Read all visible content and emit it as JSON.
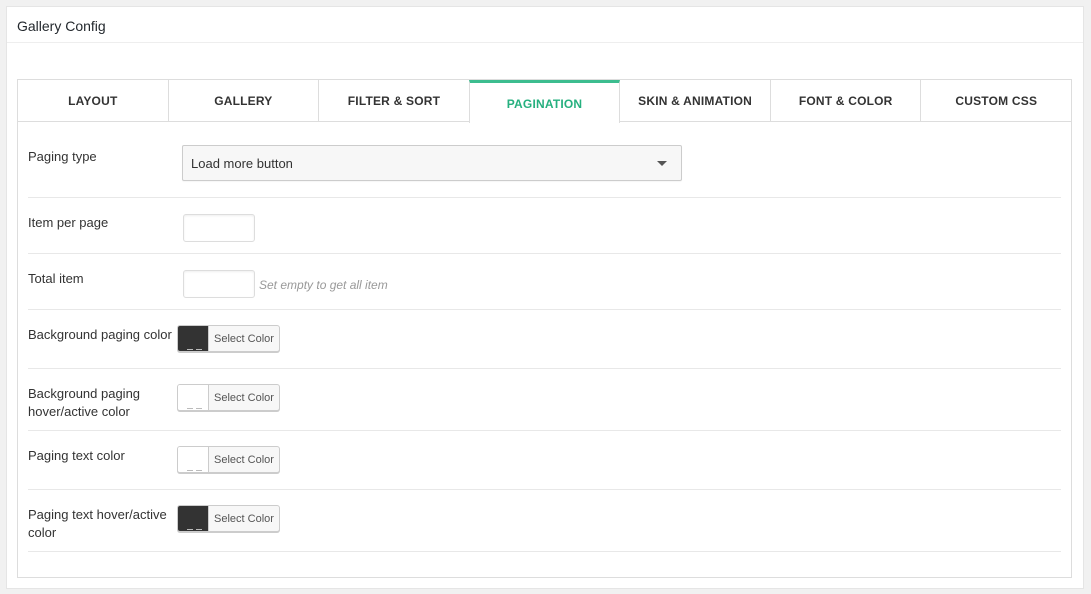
{
  "panel": {
    "title": "Gallery Config"
  },
  "tabs": [
    {
      "label": "LAYOUT",
      "active": false
    },
    {
      "label": "GALLERY",
      "active": false
    },
    {
      "label": "FILTER & SORT",
      "active": false
    },
    {
      "label": "PAGINATION",
      "active": true
    },
    {
      "label": "SKIN & ANIMATION",
      "active": false
    },
    {
      "label": "FONT & COLOR",
      "active": false
    },
    {
      "label": "CUSTOM CSS",
      "active": false
    }
  ],
  "fields": {
    "paging_type": {
      "label": "Paging type",
      "value": "Load more button"
    },
    "item_per_page": {
      "label": "Item per page",
      "value": ""
    },
    "total_item": {
      "label": "Total item",
      "value": "",
      "hint": "Set empty to get all item"
    },
    "bg_paging_color": {
      "label": "Background paging color",
      "button": "Select Color",
      "color": "#333333"
    },
    "bg_paging_hover_color": {
      "label": "Background paging hover/active color",
      "button": "Select Color",
      "color": "#ffffff"
    },
    "paging_text_color": {
      "label": "Paging text color",
      "button": "Select Color",
      "color": "#ffffff"
    },
    "paging_text_hover_color": {
      "label": "Paging text hover/active color",
      "button": "Select Color",
      "color": "#333333"
    }
  },
  "colors": {
    "accent": "#3cbd8f",
    "accent_text": "#26b07f"
  }
}
